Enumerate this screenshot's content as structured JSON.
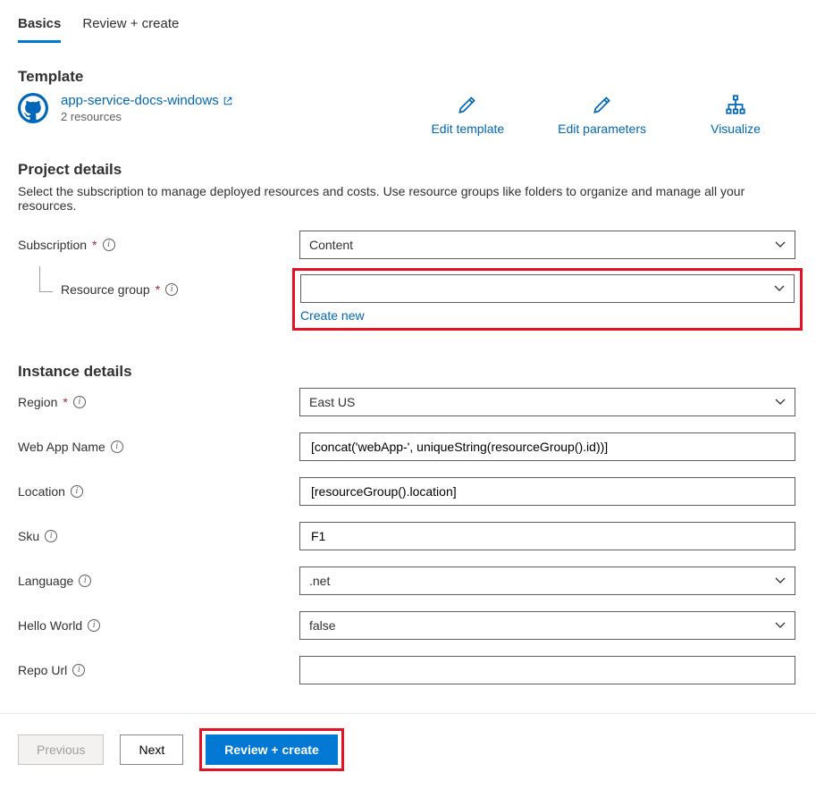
{
  "tabs": {
    "basics": "Basics",
    "review": "Review + create"
  },
  "template": {
    "heading": "Template",
    "link_text": "app-service-docs-windows",
    "resource_count": "2 resources",
    "actions": {
      "edit_template": "Edit template",
      "edit_params": "Edit parameters",
      "visualize": "Visualize"
    }
  },
  "project": {
    "heading": "Project details",
    "desc": "Select the subscription to manage deployed resources and costs. Use resource groups like folders to organize and manage all your resources.",
    "subscription_label": "Subscription",
    "subscription_value": "Content",
    "rg_label": "Resource group",
    "rg_value": "",
    "rg_create_new": "Create new"
  },
  "instance": {
    "heading": "Instance details",
    "region_label": "Region",
    "region_value": "East US",
    "webapp_label": "Web App Name",
    "webapp_value": "[concat('webApp-', uniqueString(resourceGroup().id))]",
    "location_label": "Location",
    "location_value": "[resourceGroup().location]",
    "sku_label": "Sku",
    "sku_value": "F1",
    "language_label": "Language",
    "language_value": ".net",
    "hello_label": "Hello World",
    "hello_value": "false",
    "repo_label": "Repo Url",
    "repo_value": ""
  },
  "footer": {
    "previous": "Previous",
    "next": "Next",
    "review": "Review + create"
  }
}
